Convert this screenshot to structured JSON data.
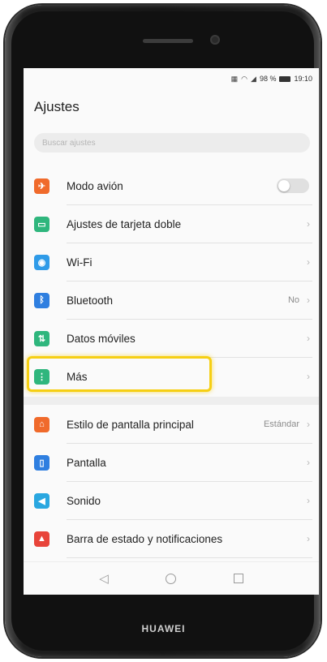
{
  "status_bar": {
    "battery": "98 %",
    "time": "19:10"
  },
  "header": {
    "title": "Ajustes"
  },
  "search": {
    "placeholder": "Buscar ajustes"
  },
  "colors": {
    "highlight": "#f6cf12",
    "airplane": "#f06a2b",
    "dual_sim": "#2fb67d",
    "wifi": "#2f9be8",
    "bluetooth": "#2f7fe0",
    "mobile_data": "#2fb67d",
    "more": "#2fb67d",
    "home_style": "#f06a2b",
    "display": "#2f7fe0",
    "sound": "#2aa7e0",
    "notifications": "#e8443a"
  },
  "settings": {
    "airplane": {
      "label": "Modo avión",
      "icon": "airplane-icon",
      "toggle": "off"
    },
    "dual_sim": {
      "label": "Ajustes de tarjeta doble",
      "icon": "sim-card-icon"
    },
    "wifi": {
      "label": "Wi-Fi",
      "icon": "wifi-icon"
    },
    "bluetooth": {
      "label": "Bluetooth",
      "value": "No",
      "icon": "bluetooth-icon"
    },
    "mobile_data": {
      "label": "Datos móviles",
      "icon": "mobile-data-icon"
    },
    "more": {
      "label": "Más",
      "icon": "more-icon"
    },
    "home_style": {
      "label": "Estilo de pantalla principal",
      "value": "Estándar",
      "icon": "home-icon"
    },
    "display": {
      "label": "Pantalla",
      "icon": "display-icon"
    },
    "sound": {
      "label": "Sonido",
      "icon": "sound-icon"
    },
    "notifications": {
      "label": "Barra de estado y notificaciones",
      "icon": "notification-icon"
    }
  },
  "brand": "HUAWEI"
}
